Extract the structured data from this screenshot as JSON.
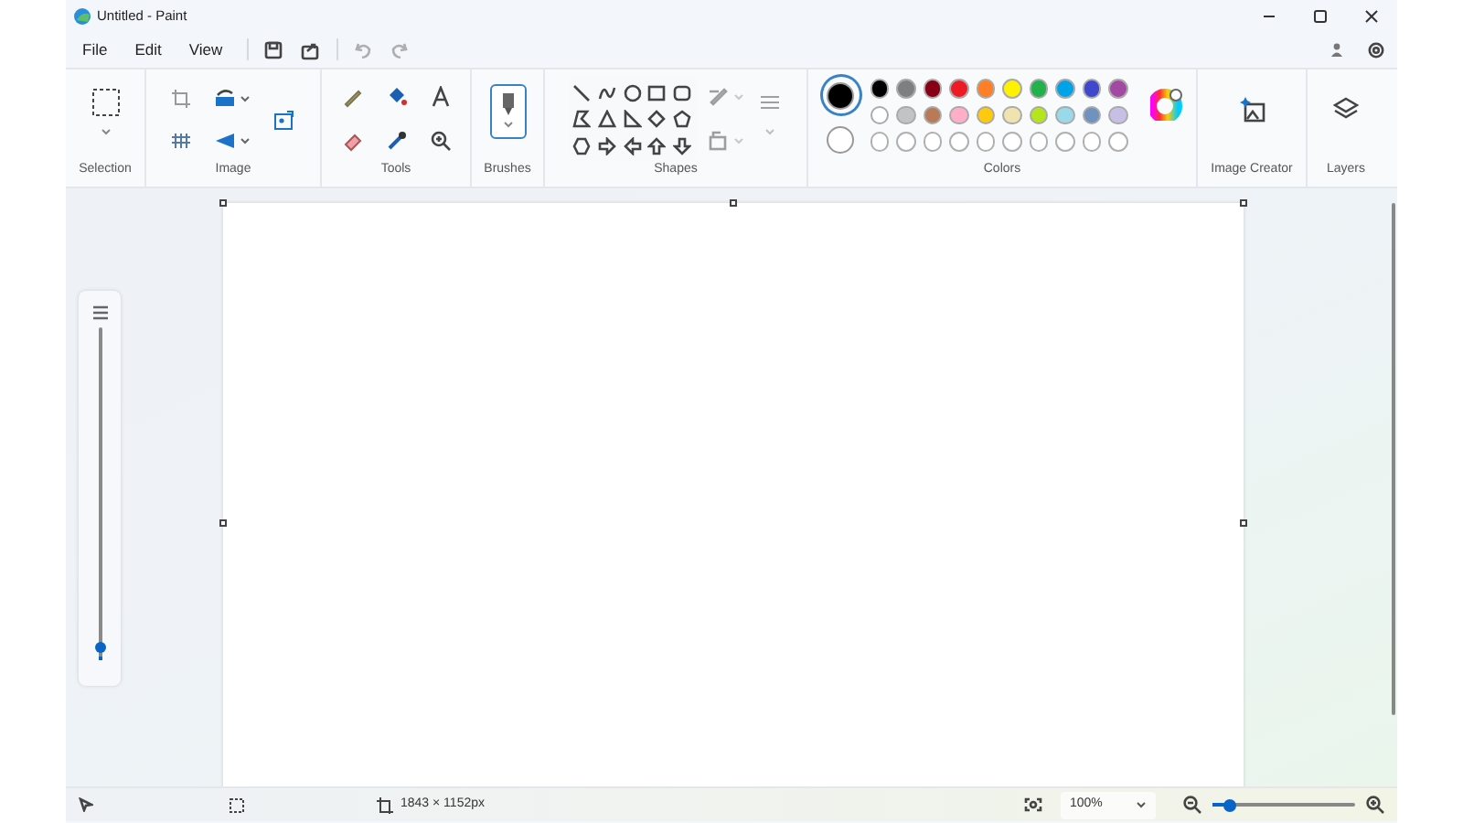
{
  "window": {
    "title": "Untitled - Paint"
  },
  "menu": [
    {
      "label": "File"
    },
    {
      "label": "Edit"
    },
    {
      "label": "View"
    }
  ],
  "quick_access": [
    {
      "kind": "save",
      "disabled": false
    },
    {
      "kind": "share",
      "disabled": false
    },
    {
      "kind": "undo",
      "disabled": true
    },
    {
      "kind": "redo",
      "disabled": true
    }
  ],
  "ribbon": {
    "groups": [
      {
        "label": "Selection"
      },
      {
        "label": "Image"
      },
      {
        "label": "Tools"
      },
      {
        "label": "Brushes"
      },
      {
        "label": "Shapes"
      },
      {
        "label": "Colors"
      },
      {
        "label": "Image Creator"
      },
      {
        "label": "Layers"
      }
    ],
    "current_colors": [
      {
        "color": "#000000",
        "selected": true
      },
      {
        "color": "#ffffff",
        "selected": false
      }
    ],
    "palette": [
      {
        "color": "#000000"
      },
      {
        "color": "#7f7f7f"
      },
      {
        "color": "#880015"
      },
      {
        "color": "#ed1c24"
      },
      {
        "color": "#ff7f27"
      },
      {
        "color": "#fff200"
      },
      {
        "color": "#22b14c"
      },
      {
        "color": "#00a2e8"
      },
      {
        "color": "#3f48cc"
      },
      {
        "color": "#a349a4"
      },
      {
        "color": "#ffffff"
      },
      {
        "color": "#c3c3c3"
      },
      {
        "color": "#b97a57"
      },
      {
        "color": "#ffaec9"
      },
      {
        "color": "#ffc90e"
      },
      {
        "color": "#efe4b0"
      },
      {
        "color": "#b5e61d"
      },
      {
        "color": "#99d9ea"
      },
      {
        "color": "#7092be"
      },
      {
        "color": "#c8bfe7"
      }
    ]
  },
  "brush_size": {
    "level": 0.0
  },
  "status_bar": {
    "dimensions": "1843 × 1152px",
    "zoom": "100%",
    "zoom_slider": {
      "level": 0.12
    }
  }
}
